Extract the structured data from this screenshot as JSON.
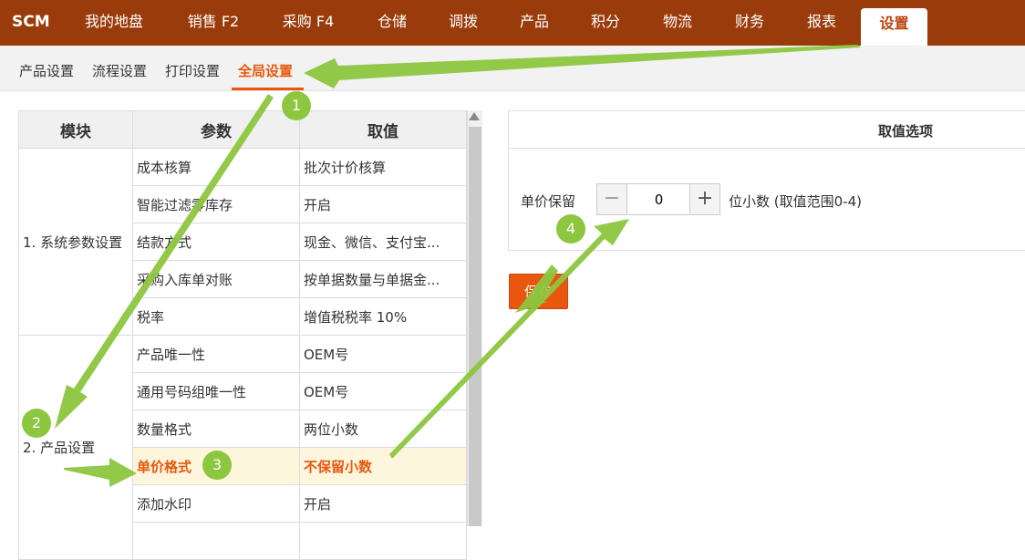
{
  "app": {
    "logo": "SCM"
  },
  "nav": [
    {
      "label": "我的地盘",
      "active": false
    },
    {
      "label": "销售 F2",
      "active": false
    },
    {
      "label": "采购 F4",
      "active": false
    },
    {
      "label": "仓储",
      "active": false
    },
    {
      "label": "调拨",
      "active": false
    },
    {
      "label": "产品",
      "active": false
    },
    {
      "label": "积分",
      "active": false
    },
    {
      "label": "物流",
      "active": false
    },
    {
      "label": "财务",
      "active": false
    },
    {
      "label": "报表",
      "active": false
    },
    {
      "label": "设置",
      "active": true
    }
  ],
  "subnav": [
    {
      "label": "产品设置",
      "active": false
    },
    {
      "label": "流程设置",
      "active": false
    },
    {
      "label": "打印设置",
      "active": false
    },
    {
      "label": "全局设置",
      "active": true
    }
  ],
  "table": {
    "headers": [
      "模块",
      "参数",
      "取值"
    ],
    "groups": [
      {
        "module": "1. 系统参数设置",
        "rows": [
          {
            "param": "成本核算",
            "value": "批次计价核算"
          },
          {
            "param": "智能过滤零库存",
            "value": "开启"
          },
          {
            "param": "结款方式",
            "value": "现金、微信、支付宝..."
          },
          {
            "param": "采购入库单对账",
            "value": "按单据数量与单据金..."
          },
          {
            "param": "税率",
            "value": "增值税税率 10%"
          }
        ]
      },
      {
        "module": "2. 产品设置",
        "rows": [
          {
            "param": "产品唯一性",
            "value": "OEM号"
          },
          {
            "param": "通用号码组唯一性",
            "value": "OEM号"
          },
          {
            "param": "数量格式",
            "value": "两位小数"
          },
          {
            "param": "单价格式",
            "value": "不保留小数",
            "highlight": true
          },
          {
            "param": "添加水印",
            "value": "开启"
          }
        ]
      }
    ]
  },
  "panel": {
    "title": "取值选项",
    "price_label": "单价保留",
    "decimal_value": "0",
    "unit_text": "位小数 (取值范围0-4)",
    "minus": "−",
    "plus": "+"
  },
  "save_label": "保存",
  "annotations": [
    "1",
    "2",
    "3",
    "4"
  ],
  "colors": {
    "topbar": "#9a3b0b",
    "accent": "#e8570d",
    "arrow": "#8dc63f",
    "highlight_row": "#fdf6dc"
  }
}
